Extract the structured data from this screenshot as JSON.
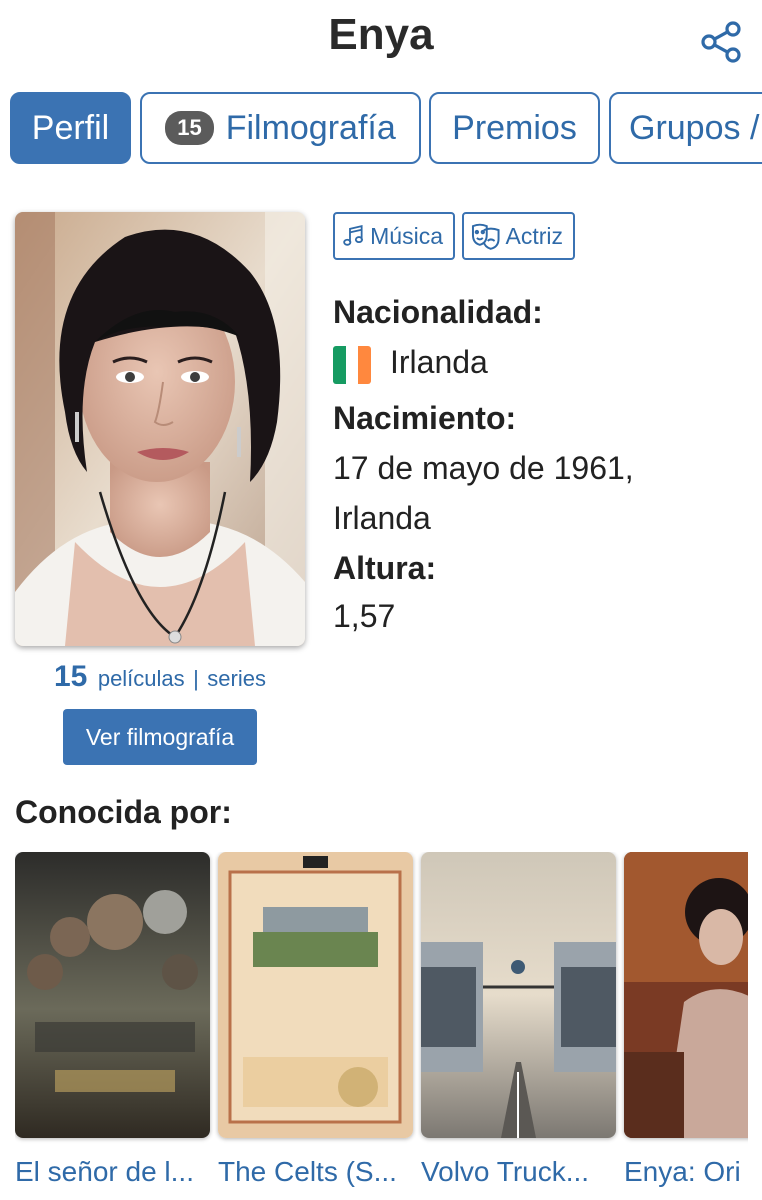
{
  "header": {
    "title": "Enya",
    "share_icon": "share-icon"
  },
  "tabs": [
    {
      "label": "Perfil",
      "active": true
    },
    {
      "label": "Filmografía",
      "count": "15",
      "active": false
    },
    {
      "label": "Premios",
      "active": false
    },
    {
      "label": "Grupos /",
      "active": false
    }
  ],
  "profile": {
    "counts": {
      "number": "15",
      "films_label": "películas",
      "separator": "|",
      "series_label": "series"
    },
    "filmography_button": "Ver filmografía",
    "roles": [
      {
        "label": "Música",
        "icon": "music-note-icon"
      },
      {
        "label": "Actriz",
        "icon": "theater-masks-icon"
      }
    ],
    "nationality_label": "Nacionalidad:",
    "nationality_value": "Irlanda",
    "flag_colors": [
      "#169b62",
      "#ffffff",
      "#ff883e"
    ],
    "birth_label": "Nacimiento:",
    "birth_line1": "17 de mayo de 1961,",
    "birth_line2": "Irlanda",
    "height_label": "Altura:",
    "height_value": "1,57"
  },
  "known_for": {
    "heading": "Conocida por:",
    "items": [
      {
        "title": "El señor de l..."
      },
      {
        "title": "The Celts (S..."
      },
      {
        "title": "Volvo Truck..."
      },
      {
        "title": "Enya: Ori"
      }
    ]
  },
  "colors": {
    "accent": "#3b73b3",
    "link": "#2f6aa8"
  }
}
